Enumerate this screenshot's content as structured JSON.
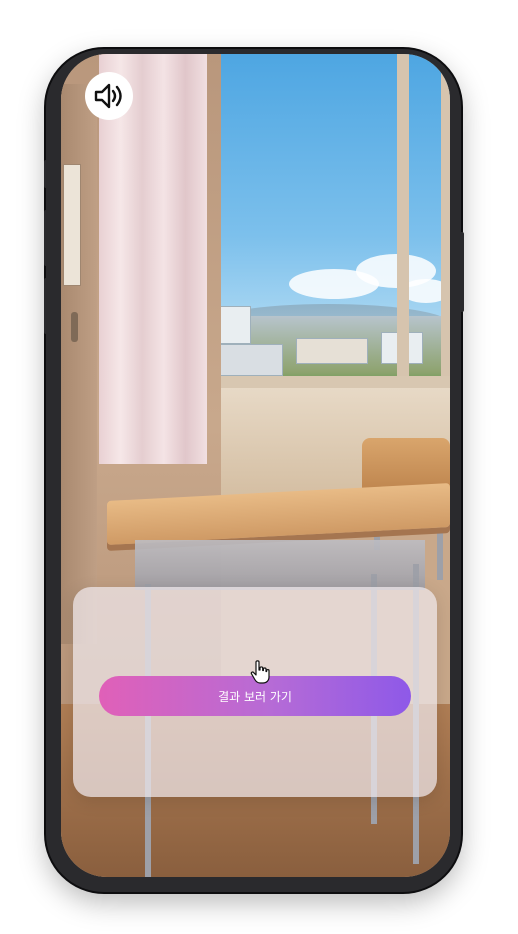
{
  "sound_button": {
    "icon": "speaker-volume-icon"
  },
  "result_card": {
    "button_label": "결과 보러 가기"
  },
  "cursor": {
    "icon": "hand-pointer-icon"
  },
  "colors": {
    "button_gradient_start": "#e060b8",
    "button_gradient_end": "#8e59e8",
    "phone_frame": "#2a2a2d",
    "card_background": "#eee8ec"
  }
}
